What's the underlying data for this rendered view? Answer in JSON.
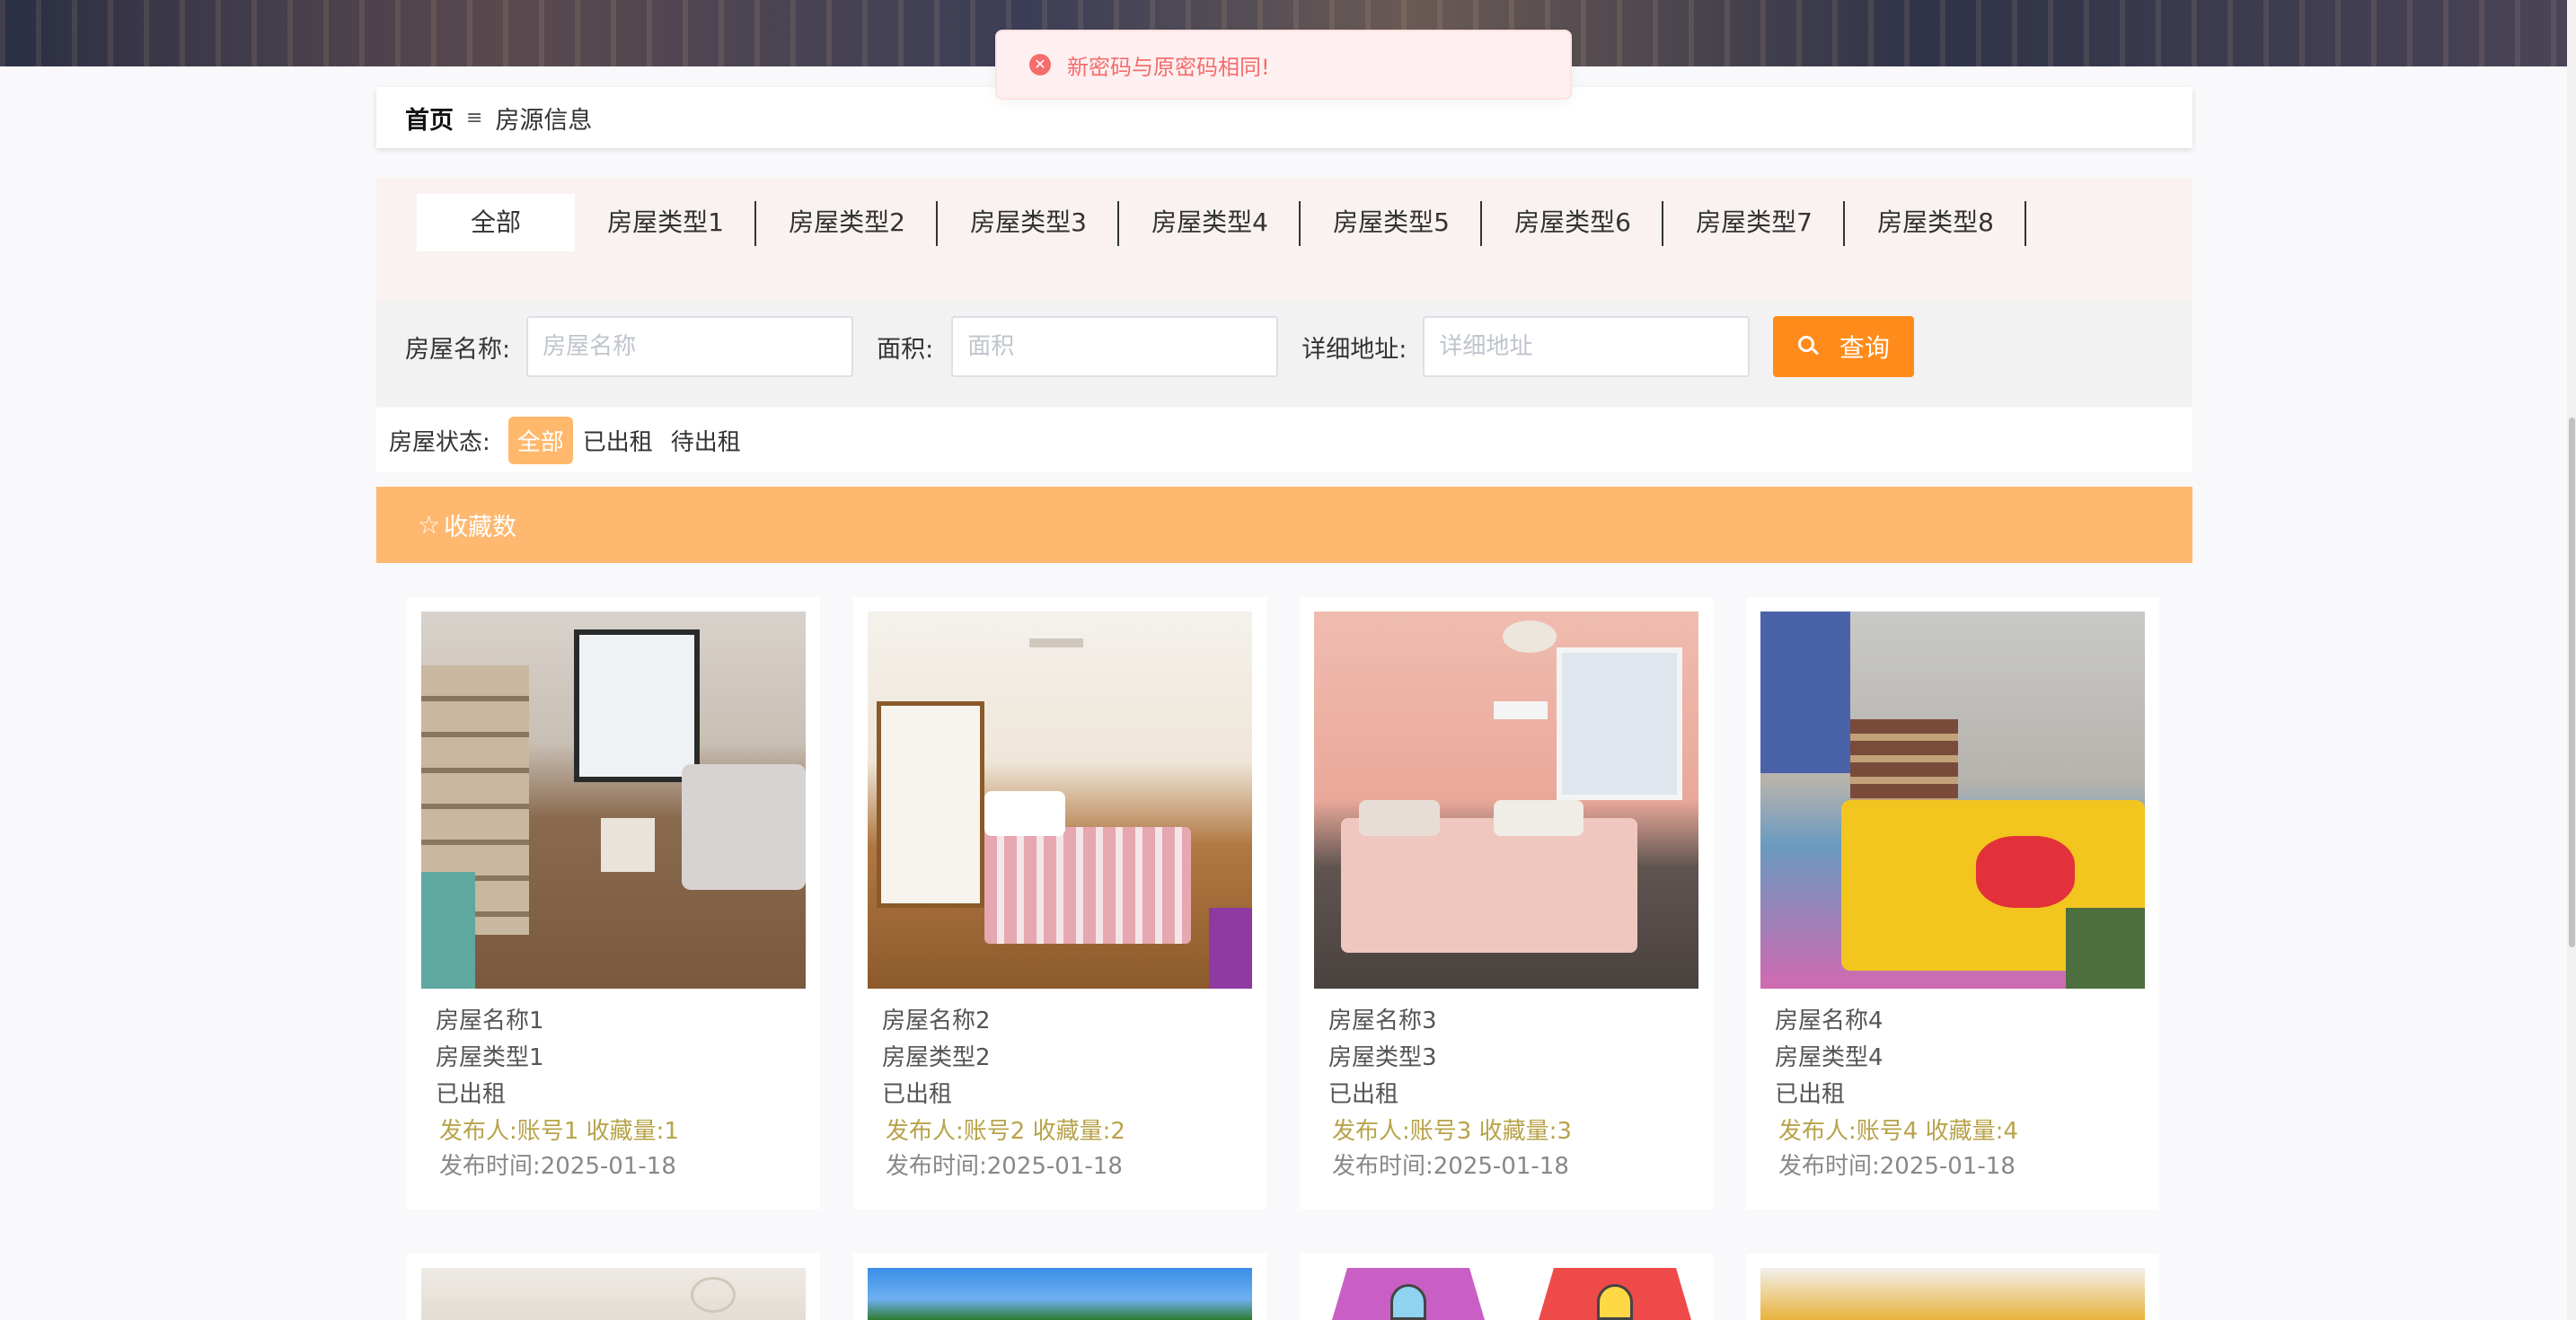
{
  "toast": {
    "message": "新密码与原密码相同!",
    "icon": "close-circle-icon",
    "color": "#f56c6c"
  },
  "breadcrumb": {
    "home": "首页",
    "separator": "≡",
    "current": "房源信息"
  },
  "type_tabs": [
    "全部",
    "房屋类型1",
    "房屋类型2",
    "房屋类型3",
    "房屋类型4",
    "房屋类型5",
    "房屋类型6",
    "房屋类型7",
    "房屋类型8"
  ],
  "search": {
    "name_label": "房屋名称:",
    "name_placeholder": "房屋名称",
    "area_label": "面积:",
    "area_placeholder": "面积",
    "address_label": "详细地址:",
    "address_placeholder": "详细地址",
    "query_button": "查询",
    "query_color": "#ff8c1a"
  },
  "status_filter": {
    "label": "房屋状态:",
    "options": [
      "全部",
      "已出租",
      "待出租"
    ],
    "selected": "全部"
  },
  "sort_bar": {
    "label": "收藏数",
    "icon": "star-icon",
    "color": "#ffb870"
  },
  "cards": [
    {
      "name": "房屋名称1",
      "type": "房屋类型1",
      "status": "已出租",
      "publisher_line": "发布人:账号1  收藏量:1",
      "date_line": "发布时间:2025-01-18"
    },
    {
      "name": "房屋名称2",
      "type": "房屋类型2",
      "status": "已出租",
      "publisher_line": "发布人:账号2  收藏量:2",
      "date_line": "发布时间:2025-01-18"
    },
    {
      "name": "房屋名称3",
      "type": "房屋类型3",
      "status": "已出租",
      "publisher_line": "发布人:账号3  收藏量:3",
      "date_line": "发布时间:2025-01-18"
    },
    {
      "name": "房屋名称4",
      "type": "房屋类型4",
      "status": "已出租",
      "publisher_line": "发布人:账号4  收藏量:4",
      "date_line": "发布时间:2025-01-18"
    }
  ]
}
